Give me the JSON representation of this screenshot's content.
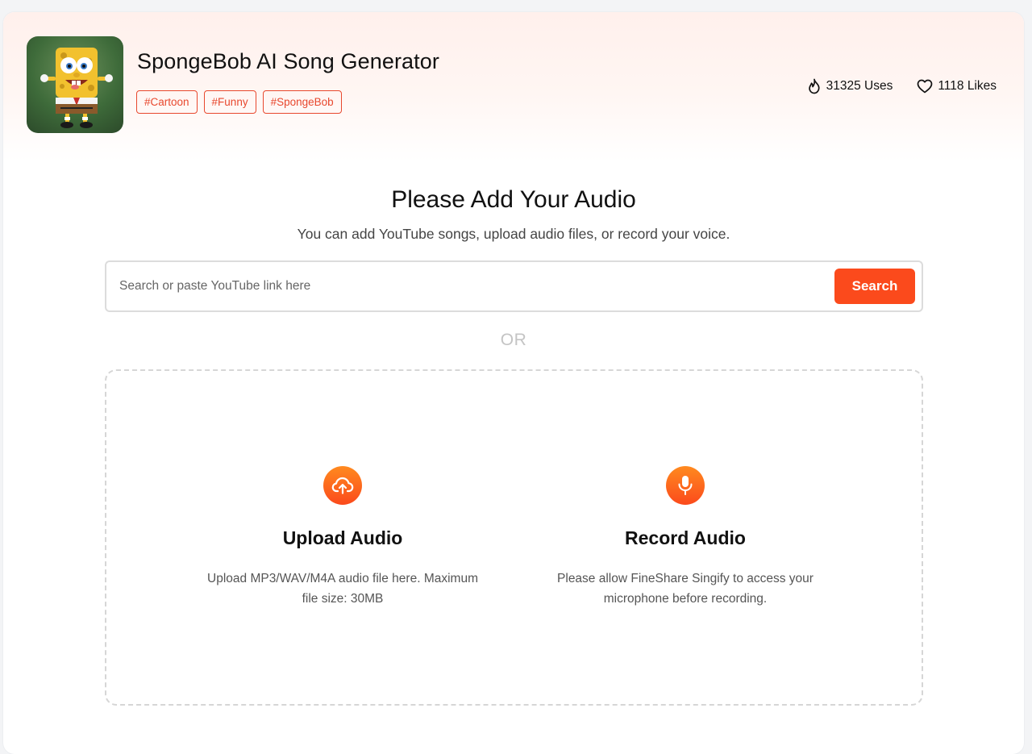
{
  "header": {
    "title": "SpongeBob AI Song Generator",
    "tags": [
      "#Cartoon",
      "#Funny",
      "#SpongeBob"
    ],
    "uses": "31325 Uses",
    "likes": "1118 Likes"
  },
  "main": {
    "title": "Please Add Your Audio",
    "subtitle": "You can add YouTube songs, upload audio files, or record your voice.",
    "search_placeholder": "Search or paste YouTube link here",
    "search_button": "Search",
    "or_label": "OR",
    "upload": {
      "title": "Upload Audio",
      "description": "Upload MP3/WAV/M4A audio file here. Maximum file size: 30MB"
    },
    "record": {
      "title": "Record Audio",
      "description": "Please allow FineShare Singify to access your microphone before recording."
    }
  },
  "colors": {
    "accent": "#fb4a1c",
    "tag": "#e8482e",
    "icon_gradient_top": "#ff8a1f"
  },
  "icons": [
    "flame-icon",
    "heart-icon",
    "cloud-upload-icon",
    "microphone-icon"
  ]
}
